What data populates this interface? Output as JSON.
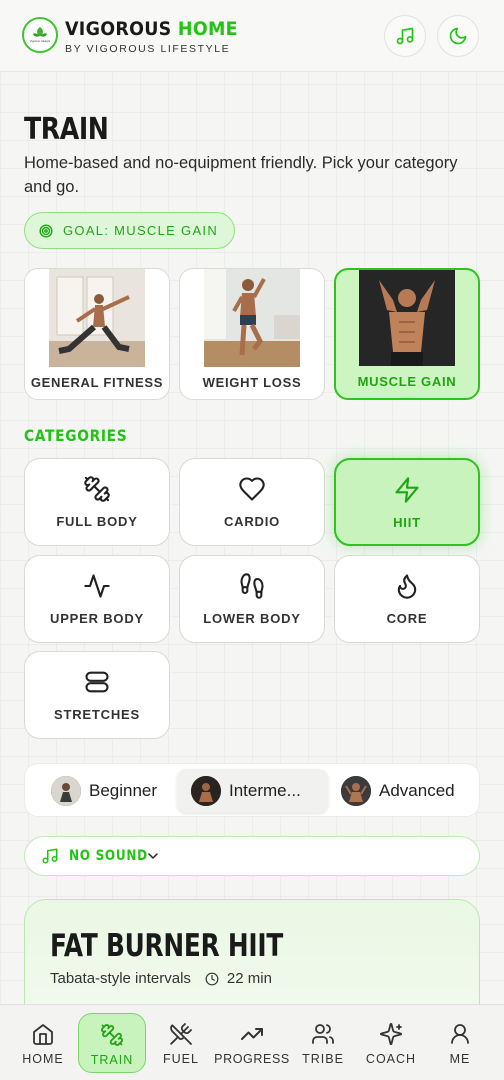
{
  "header": {
    "title_part1": "VIGOROUS",
    "title_part2": "HOME",
    "subtitle": "BY VIGOROUS LIFESTYLE",
    "logo_text": "Vigorous Lifestyle",
    "music_icon": "music-note-icon",
    "theme_icon": "moon-icon"
  },
  "page": {
    "title": "TRAIN",
    "description": "Home-based and no-equipment friendly. Pick your category and go.",
    "goal_label": "GOAL: MUSCLE GAIN"
  },
  "programs": [
    {
      "label": "GENERAL FITNESS",
      "active": false
    },
    {
      "label": "WEIGHT LOSS",
      "active": false
    },
    {
      "label": "MUSCLE GAIN",
      "active": true
    }
  ],
  "categories_title": "CATEGORIES",
  "categories": [
    {
      "label": "FULL BODY",
      "icon": "dumbbell-icon",
      "active": false
    },
    {
      "label": "CARDIO",
      "icon": "heart-icon",
      "active": false
    },
    {
      "label": "HIIT",
      "icon": "lightning-icon",
      "active": true
    },
    {
      "label": "UPPER BODY",
      "icon": "pulse-icon",
      "active": false
    },
    {
      "label": "LOWER BODY",
      "icon": "footprints-icon",
      "active": false
    },
    {
      "label": "CORE",
      "icon": "flame-icon",
      "active": false
    },
    {
      "label": "STRETCHES",
      "icon": "stretch-icon",
      "active": false
    }
  ],
  "levels": [
    {
      "label": "Beginner",
      "active": false
    },
    {
      "label": "Interme...",
      "active": true
    },
    {
      "label": "Advanced",
      "active": false
    }
  ],
  "sound": {
    "label": "NO SOUND",
    "icon": "music-note-icon"
  },
  "workout": {
    "title": "FAT BURNER HIIT",
    "subtitle": "Tabata-style intervals",
    "duration": "22 min"
  },
  "nav": [
    {
      "label": "HOME",
      "icon": "home-icon",
      "active": false
    },
    {
      "label": "TRAIN",
      "icon": "dumbbell-icon",
      "active": true
    },
    {
      "label": "FUEL",
      "icon": "utensils-icon",
      "active": false
    },
    {
      "label": "PROGRESS",
      "icon": "trending-up-icon",
      "active": false
    },
    {
      "label": "TRIBE",
      "icon": "users-icon",
      "active": false
    },
    {
      "label": "COACH",
      "icon": "sparkles-icon",
      "active": false
    },
    {
      "label": "ME",
      "icon": "user-icon",
      "active": false
    }
  ],
  "colors": {
    "accent": "#22c414",
    "accent_bg": "#c8f3bd",
    "page_bg": "#f5f6f4"
  }
}
